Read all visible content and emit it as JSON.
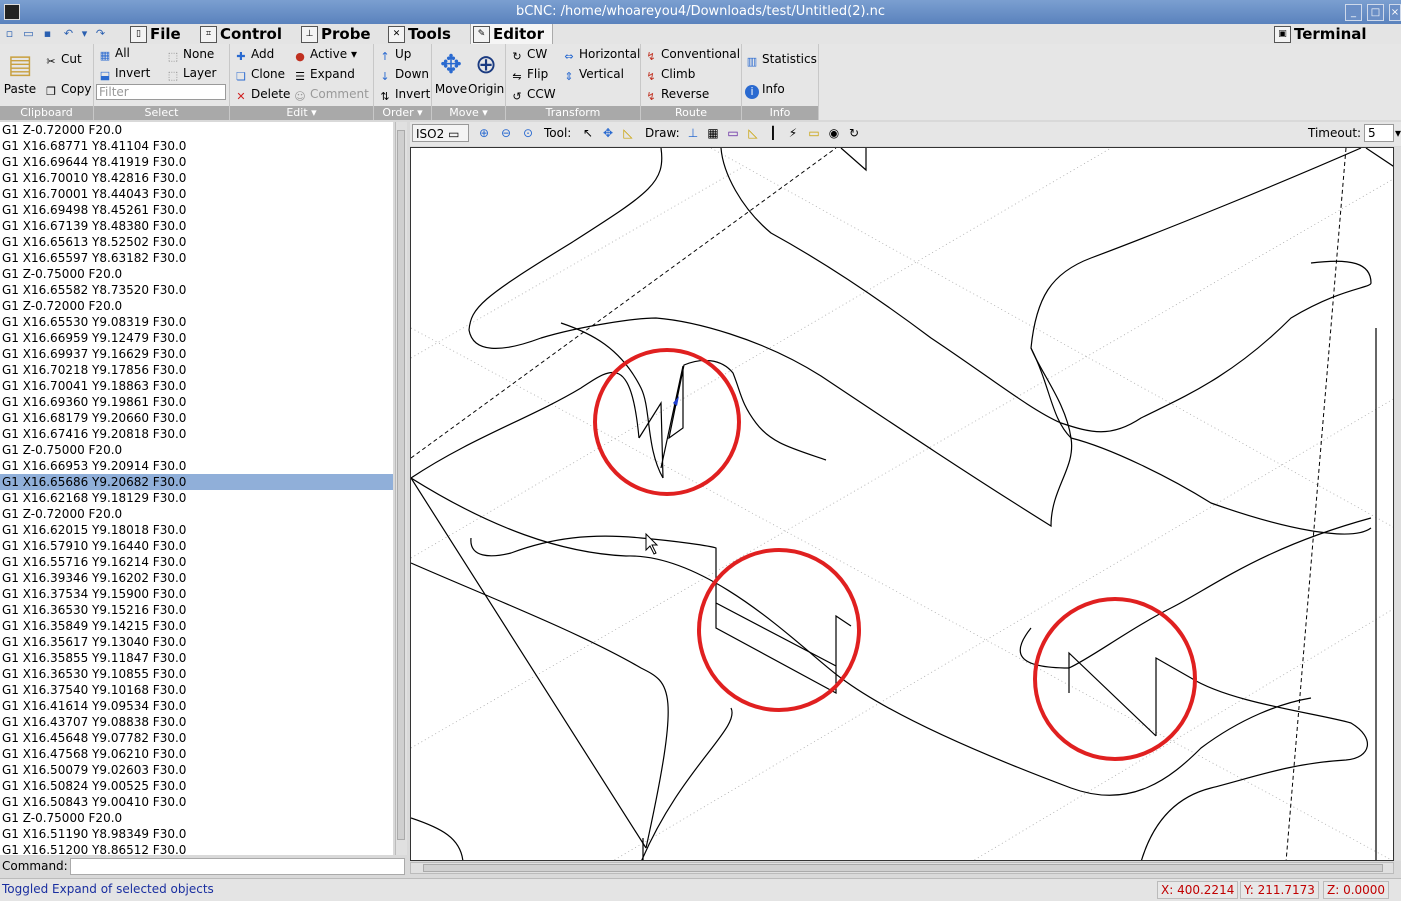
{
  "window": {
    "title": "bCNC: /home/whoareyou4/Downloads/test/Untitled(2).nc"
  },
  "menubar": {
    "tabs": [
      {
        "label": "File",
        "icon": "file-icon"
      },
      {
        "label": "Control",
        "icon": "control-icon"
      },
      {
        "label": "Probe",
        "icon": "probe-icon"
      },
      {
        "label": "Tools",
        "icon": "tools-icon"
      },
      {
        "label": "Editor",
        "icon": "editor-icon",
        "active": true
      }
    ],
    "terminal_label": "Terminal"
  },
  "ribbon": {
    "clipboard": {
      "label": "Clipboard",
      "paste": "Paste",
      "cut": "Cut",
      "copy": "Copy"
    },
    "select": {
      "label": "Select",
      "all": "All",
      "none": "None",
      "invert": "Invert",
      "layer": "Layer",
      "filter_placeholder": "Filter"
    },
    "edit": {
      "label": "Edit",
      "add": "Add",
      "active": "Active",
      "clone": "Clone",
      "expand": "Expand",
      "delete": "Delete",
      "comment": "Comment"
    },
    "order": {
      "label": "Order",
      "up": "Up",
      "down": "Down",
      "invert": "Invert"
    },
    "move": {
      "label": "Move",
      "move": "Move",
      "origin": "Origin"
    },
    "transform": {
      "label": "Transform",
      "cw": "CW",
      "horizontal": "Horizontal",
      "flip": "Flip",
      "vertical": "Vertical",
      "ccw": "CCW"
    },
    "route": {
      "label": "Route",
      "conventional": "Conventional",
      "climb": "Climb",
      "reverse": "Reverse"
    },
    "info": {
      "label": "Info",
      "statistics": "Statistics",
      "info": "Info"
    }
  },
  "gcode_lines": [
    "G1 Z-0.72000 F20.0",
    "G1 X16.68771 Y8.41104 F30.0",
    "G1 X16.69644 Y8.41919 F30.0",
    "G1 X16.70010 Y8.42816 F30.0",
    "G1 X16.70001 Y8.44043 F30.0",
    "G1 X16.69498 Y8.45261 F30.0",
    "G1 X16.67139 Y8.48380 F30.0",
    "G1 X16.65613 Y8.52502 F30.0",
    "G1 X16.65597 Y8.63182 F30.0",
    "G1 Z-0.75000 F20.0",
    "G1 X16.65582 Y8.73520 F30.0",
    "G1 Z-0.72000 F20.0",
    "G1 X16.65530 Y9.08319 F30.0",
    "G1 X16.66959 Y9.12479 F30.0",
    "G1 X16.69937 Y9.16629 F30.0",
    "G1 X16.70218 Y9.17856 F30.0",
    "G1 X16.70041 Y9.18863 F30.0",
    "G1 X16.69360 Y9.19861 F30.0",
    "G1 X16.68179 Y9.20660 F30.0",
    "G1 X16.67416 Y9.20818 F30.0",
    "G1 Z-0.75000 F20.0",
    "G1 X16.66953 Y9.20914 F30.0",
    "G1 X16.65686 Y9.20682 F30.0",
    "G1 X16.62168 Y9.18129 F30.0",
    "G1 Z-0.72000 F20.0",
    "G1 X16.62015 Y9.18018 F30.0",
    "G1 X16.57910 Y9.16440 F30.0",
    "G1 X16.55716 Y9.16214 F30.0",
    "G1 X16.39346 Y9.16202 F30.0",
    "G1 X16.37534 Y9.15900 F30.0",
    "G1 X16.36530 Y9.15216 F30.0",
    "G1 X16.35849 Y9.14215 F30.0",
    "G1 X16.35617 Y9.13040 F30.0",
    "G1 X16.35855 Y9.11847 F30.0",
    "G1 X16.36530 Y9.10855 F30.0",
    "G1 X16.37540 Y9.10168 F30.0",
    "G1 X16.41614 Y9.09534 F30.0",
    "G1 X16.43707 Y9.08838 F30.0",
    "G1 X16.45648 Y9.07782 F30.0",
    "G1 X16.47568 Y9.06210 F30.0",
    "G1 X16.50079 Y9.02603 F30.0",
    "G1 X16.50824 Y9.00525 F30.0",
    "G1 X16.50843 Y9.00410 F30.0",
    "G1 Z-0.75000 F20.0",
    "G1 X16.51190 Y8.98349 F30.0",
    "G1 X16.51200 Y8.86512 F30.0"
  ],
  "selected_line_index": 22,
  "command": {
    "label": "Command:",
    "value": ""
  },
  "canvas_toolbar": {
    "view": "ISO2",
    "tool_label": "Tool:",
    "draw_label": "Draw:",
    "timeout_label": "Timeout:",
    "timeout_value": "5"
  },
  "status": {
    "message": "Toggled Expand of selected objects",
    "x": "X: 400.2214",
    "y": "Y: 211.7173",
    "z": "Z: 0.0000"
  },
  "colors": {
    "highlight": "#90afd9",
    "circle": "#e02020",
    "coord_text": "#c00000",
    "status_text": "#1a2fa0"
  }
}
